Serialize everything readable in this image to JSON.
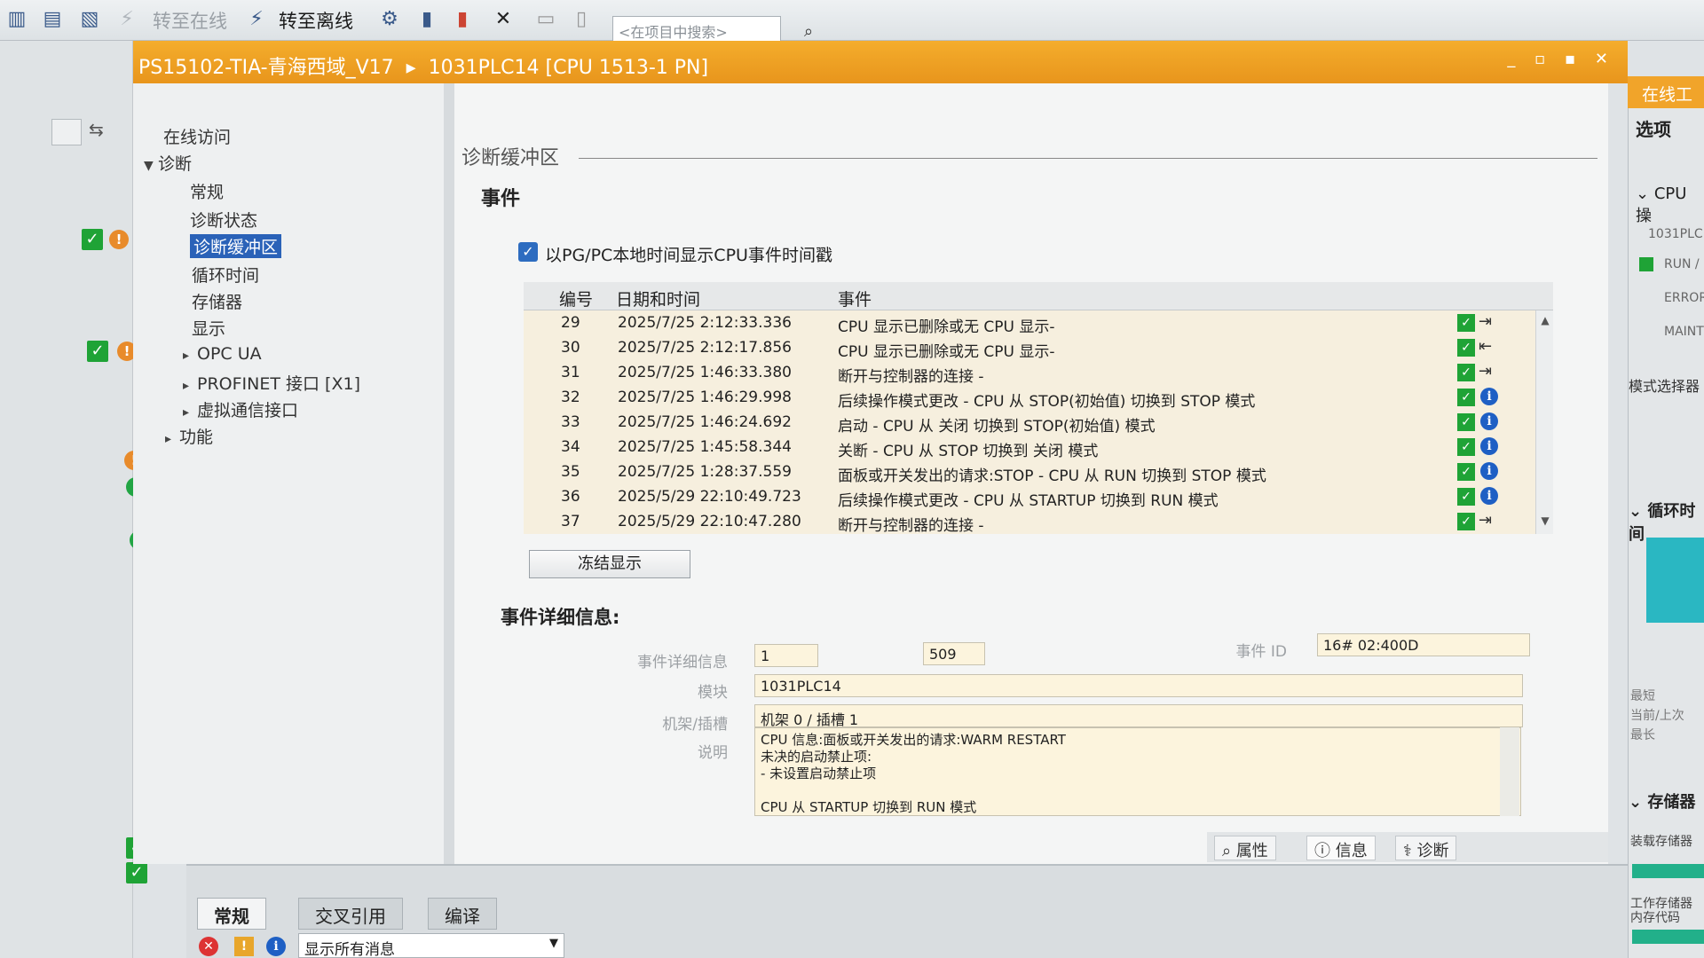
{
  "toolbar": {
    "go_online": "转至在线",
    "go_offline": "转至离线",
    "search_placeholder": "<在项目中搜索>"
  },
  "titlebar": {
    "project": "PS15102-TIA-青海西域_V17",
    "device": "1031PLC14 [CPU 1513-1 PN]",
    "window_buttons": "_ ▫ ▪ ✕"
  },
  "right_panel": {
    "header": "在线工",
    "options": "选项",
    "cpu_section": "CPU 操",
    "plc": "1031PLC1",
    "run": "RUN /",
    "error": "ERROR",
    "maint": "MAINT",
    "mode_selector": "模式选择器",
    "cycle_section": "循环时间",
    "shortest": "最短",
    "current": "当前/上次",
    "longest": "最长",
    "memory_section": "存储器",
    "load_memory": "装载存储器",
    "work_memory": "工作存储器",
    "work_memory_sub": "内存代码"
  },
  "nav": {
    "online_access": "在线访问",
    "diagnostics": "诊断",
    "general": "常规",
    "diag_status": "诊断状态",
    "diag_buffer": "诊断缓冲区",
    "cycle_time": "循环时间",
    "memory": "存储器",
    "display": "显示",
    "opc_ua": "OPC UA",
    "profinet": "PROFINET 接口 [X1]",
    "virtual_if": "虚拟通信接口",
    "functions": "功能"
  },
  "main": {
    "heading": "诊断缓冲区",
    "events_title": "事件",
    "checkbox_label": "以PG/PC本地时间显示CPU事件时间戳",
    "columns": [
      "编号",
      "日期和时间",
      "事件"
    ],
    "rows": [
      {
        "no": "29",
        "time": "2025/7/25 2:12:33.336",
        "event": "CPU 显示已删除或无 CPU 显示-",
        "icon": "arrow"
      },
      {
        "no": "30",
        "time": "2025/7/25 2:12:17.856",
        "event": "CPU 显示已删除或无 CPU 显示-",
        "icon": "arrow"
      },
      {
        "no": "31",
        "time": "2025/7/25 1:46:33.380",
        "event": "断开与控制器的连接 -",
        "icon": "arrow"
      },
      {
        "no": "32",
        "time": "2025/7/25 1:46:29.998",
        "event": "后续操作模式更改 - CPU 从 STOP(初始值) 切换到 STOP 模式",
        "icon": "info"
      },
      {
        "no": "33",
        "time": "2025/7/25 1:46:24.692",
        "event": "启动 - CPU 从 关闭 切换到 STOP(初始值) 模式",
        "icon": "info"
      },
      {
        "no": "34",
        "time": "2025/7/25 1:45:58.344",
        "event": "关断 - CPU 从 STOP 切换到 关闭 模式",
        "icon": "info"
      },
      {
        "no": "35",
        "time": "2025/7/25 1:28:37.559",
        "event": "面板或开关发出的请求:STOP - CPU 从 RUN 切换到 STOP 模式",
        "icon": "info"
      },
      {
        "no": "36",
        "time": "2025/5/29 22:10:49.723",
        "event": "后续操作模式更改 - CPU 从 STARTUP 切换到 RUN 模式",
        "icon": "info"
      },
      {
        "no": "37",
        "time": "2025/5/29 22:10:47.280",
        "event": "断开与控制器的连接 -",
        "icon": "arrow"
      }
    ],
    "freeze_button": "冻结显示",
    "detail_title": "事件详细信息:",
    "detail_label": "事件详细信息",
    "detail_value1": "1",
    "detail_value2": "509",
    "event_id_label": "事件 ID",
    "event_id": "16# 02:400D",
    "module_label": "模块",
    "module": "1031PLC14",
    "rack_label": "机架/插槽",
    "rack": "机架 0 / 插槽 1",
    "desc_label": "说明",
    "description": "CPU 信息:面板或开关发出的请求:WARM RESTART\n未决的启动禁止项:\n- 未设置启动禁止项\n\nCPU 从 STARTUP 切换到 RUN 模式"
  },
  "bottom": {
    "props_tab": "属性",
    "info_tab": "信息",
    "diag_tab": "诊断",
    "tab_general": "常规",
    "tab_xref": "交叉引用",
    "tab_compile": "编译",
    "filter": "显示所有消息"
  }
}
